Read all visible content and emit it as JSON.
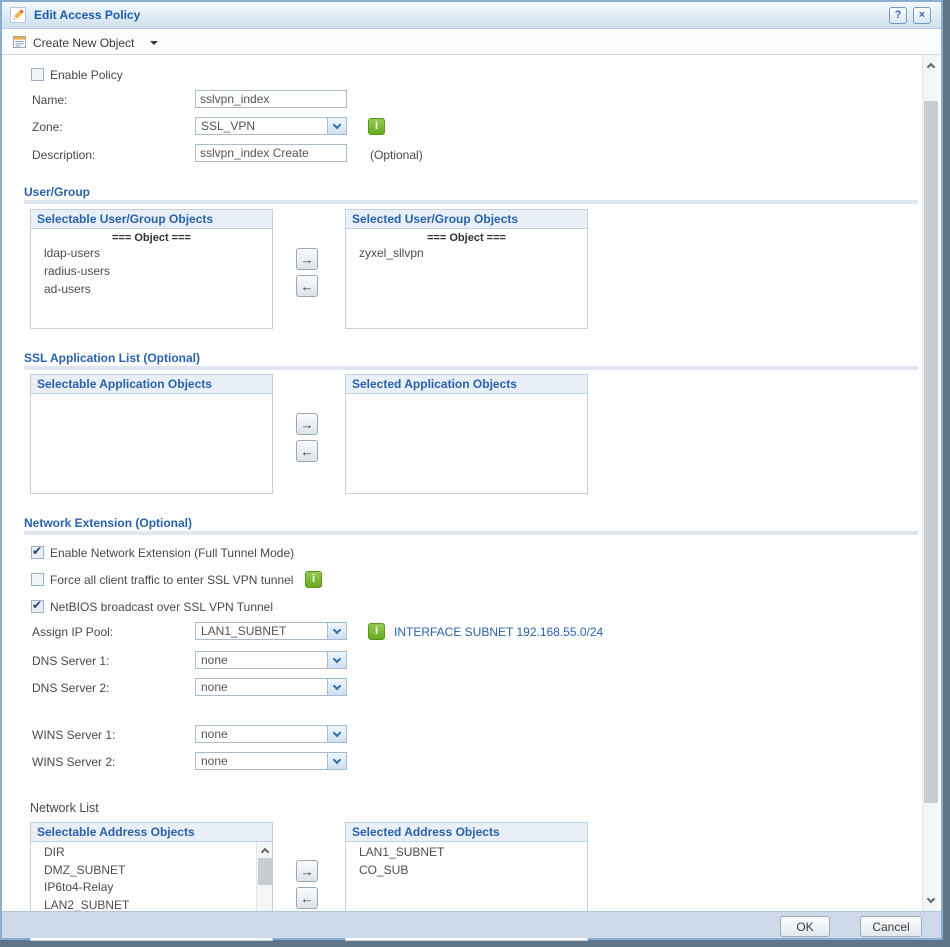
{
  "window": {
    "title": "Edit Access Policy",
    "help_label": "?",
    "close_label": "×"
  },
  "toolbar": {
    "create_new_object": "Create New Object"
  },
  "form": {
    "enable_policy": {
      "label": "Enable Policy",
      "checked": false
    },
    "name": {
      "label": "Name:",
      "value": "sslvpn_index"
    },
    "zone": {
      "label": "Zone:",
      "value": "SSL_VPN"
    },
    "description": {
      "label": "Description:",
      "value": "sslvpn_index Create",
      "hint": "(Optional)"
    }
  },
  "user_group": {
    "title": "User/Group",
    "selectable": {
      "header": "Selectable User/Group Objects",
      "group_label": "=== Object ===",
      "items": [
        "ldap-users",
        "radius-users",
        "ad-users"
      ]
    },
    "selected": {
      "header": "Selected User/Group Objects",
      "group_label": "=== Object ===",
      "items": [
        "zyxel_sllvpn"
      ]
    }
  },
  "ssl_application": {
    "title": "SSL Application List (Optional)",
    "selectable": {
      "header": "Selectable Application Objects",
      "items": []
    },
    "selected": {
      "header": "Selected Application Objects",
      "items": []
    }
  },
  "network_extension": {
    "title": "Network Extension (Optional)",
    "checkboxes": [
      {
        "label": "Enable Network Extension (Full Tunnel Mode)",
        "checked": true
      },
      {
        "label": "Force all client traffic to enter SSL VPN tunnel",
        "checked": false
      },
      {
        "label": "NetBIOS broadcast over SSL VPN Tunnel",
        "checked": true
      }
    ],
    "assign_ip_pool": {
      "label": "Assign IP Pool:",
      "value": "LAN1_SUBNET",
      "info_text": "INTERFACE SUBNET 192.168.55.0/24"
    },
    "dns_server_1": {
      "label": "DNS Server 1:",
      "value": "none"
    },
    "dns_server_2": {
      "label": "DNS Server 2:",
      "value": "none"
    },
    "wins_server_1": {
      "label": "WINS Server 1:",
      "value": "none"
    },
    "wins_server_2": {
      "label": "WINS Server 2:",
      "value": "none"
    }
  },
  "network_list": {
    "title": "Network List",
    "selectable": {
      "header": "Selectable Address Objects",
      "items": [
        "DIR",
        "DMZ_SUBNET",
        "IP6to4-Relay",
        "LAN2_SUBNET"
      ]
    },
    "selected": {
      "header": "Selected Address Objects",
      "items": [
        "LAN1_SUBNET",
        "CO_SUB"
      ]
    }
  },
  "footer": {
    "ok": "OK",
    "cancel": "Cancel"
  },
  "colors": {
    "accent_blue": "#2a62ab",
    "title_blue": "#1d5ba9",
    "info_green": "#68a922",
    "header_bg": "#e8eff7",
    "footer_bg": "#cdd9e8"
  }
}
